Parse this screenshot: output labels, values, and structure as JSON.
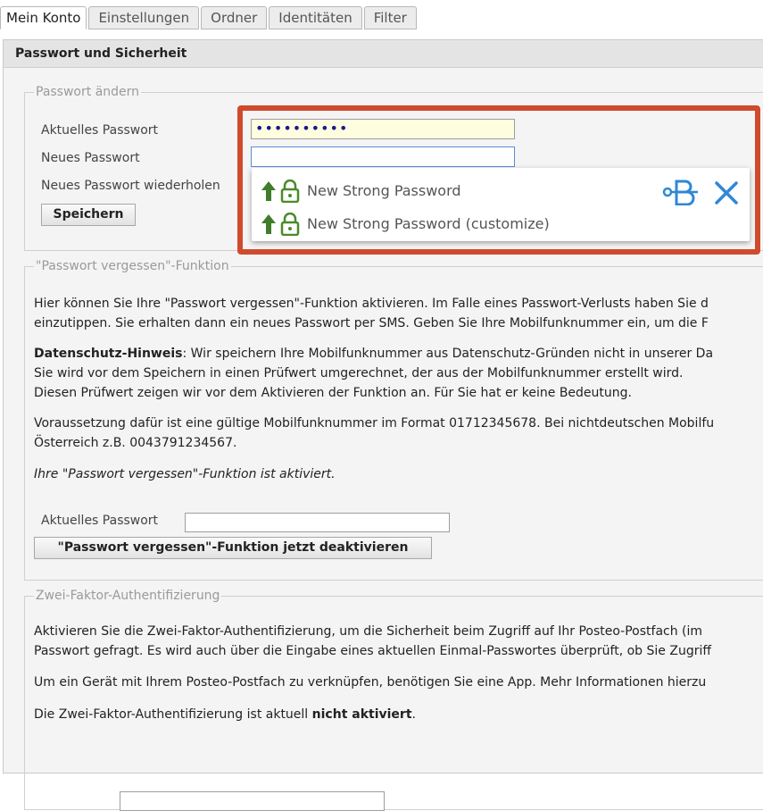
{
  "tabs": [
    "Mein Konto",
    "Einstellungen",
    "Ordner",
    "Identitäten",
    "Filter"
  ],
  "panel_title": "Passwort und Sicherheit",
  "change_pw": {
    "legend": "Passwort ändern",
    "current_label": "Aktuelles Passwort",
    "current_value": "••••••••••",
    "new_label": "Neues Passwort",
    "repeat_label": "Neues Passwort wiederholen",
    "save_button": "Speichern"
  },
  "pm_popup": {
    "item1": "New Strong Password",
    "item2": "New Strong Password (customize)",
    "accent": "#2e88d6",
    "lock_color": "#4a8a2a"
  },
  "forgot": {
    "legend": "\"Passwort vergessen\"-Funktion",
    "p1_line1": "Hier können Sie Ihre \"Passwort vergessen\"-Funktion aktivieren. Im Falle eines Passwort-Verlusts haben Sie d",
    "p1_line2": "einzutippen. Sie erhalten dann ein neues Passwort per SMS. Geben Sie Ihre Mobilfunknummer ein, um die F",
    "p2_bold": "Datenschutz-Hinweis",
    "p2_line1_rest": ": Wir speichern Ihre Mobilfunknummer aus Datenschutz-Gründen nicht in unserer Da",
    "p2_line2": "Sie wird vor dem Speichern in einen Prüfwert umgerechnet, der aus der Mobilfunknummer erstellt wird.",
    "p2_line3": "Diesen Prüfwert zeigen wir vor dem Aktivieren der Funktion an. Für Sie hat er keine Bedeutung.",
    "p3_line1": "Voraussetzung dafür ist eine gültige Mobilfunknummer im Format 01712345678. Bei nichtdeutschen Mobilfu",
    "p3_line2": "Österreich z.B. 0043791234567.",
    "status": "Ihre \"Passwort vergessen\"-Funktion ist aktiviert.",
    "current_label": "Aktuelles Passwort",
    "deactivate_bold": "\"Passwort vergessen\"",
    "deactivate_rest": "-Funktion jetzt deaktivieren"
  },
  "twofa": {
    "legend": "Zwei-Faktor-Authentifizierung",
    "p1_line1": "Aktivieren Sie die Zwei-Faktor-Authentifizierung, um die Sicherheit beim Zugriff auf Ihr Posteo-Postfach (im",
    "p1_line2": "Passwort gefragt. Es wird auch über die Eingabe eines aktuellen Einmal-Passwortes überprüft, ob Sie Zugriff",
    "p2": "Um ein Gerät mit Ihrem Posteo-Postfach zu verknüpfen, benötigen Sie eine App. Mehr Informationen hierzu",
    "p3_pre": "Die Zwei-Faktor-Authentifizierung ist aktuell ",
    "p3_bold": "nicht aktiviert",
    "p3_post": "."
  }
}
